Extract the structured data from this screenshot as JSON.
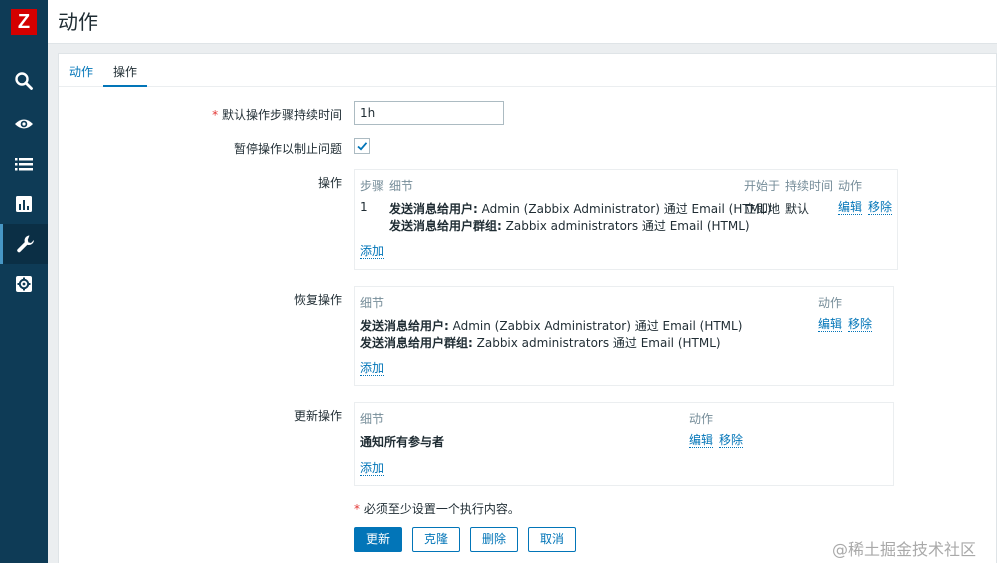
{
  "app": {
    "logo_text": "Z",
    "brand_color": "#d40000",
    "accent_color": "#0275b8"
  },
  "sidebar": {
    "items": [
      {
        "icon": "search-icon"
      },
      {
        "icon": "eye-icon"
      },
      {
        "icon": "list-icon"
      },
      {
        "icon": "chart-icon"
      },
      {
        "icon": "wrench-icon",
        "active": true
      },
      {
        "icon": "gear-icon"
      }
    ]
  },
  "header": {
    "title": "动作"
  },
  "tabs": [
    {
      "label": "动作"
    },
    {
      "label": "操作",
      "active": true
    }
  ],
  "form": {
    "step_duration": {
      "required_mark": "*",
      "label": "默认操作步骤持续时间",
      "value": "1h"
    },
    "pause": {
      "label": "暂停操作以制止问题",
      "checked": true
    },
    "operations": {
      "label": "操作",
      "headers": {
        "step": "步骤",
        "details": "细节",
        "start": "开始于",
        "duration": "持续时间",
        "action": "动作"
      },
      "rows": [
        {
          "step": "1",
          "line1_bold": "发送消息给用户:",
          "line1_text": " Admin (Zabbix Administrator) 通过 Email (HTML)",
          "line2_bold": "发送消息给用户群组:",
          "line2_text": " Zabbix administrators 通过 Email (HTML)",
          "start": "立即地",
          "duration": "默认",
          "edit": "编辑",
          "remove": "移除"
        }
      ],
      "add": "添加"
    },
    "recovery": {
      "label": "恢复操作",
      "headers": {
        "details": "细节",
        "action": "动作"
      },
      "rows": [
        {
          "line1_bold": "发送消息给用户:",
          "line1_text": " Admin (Zabbix Administrator) 通过 Email (HTML)",
          "line2_bold": "发送消息给用户群组:",
          "line2_text": " Zabbix administrators 通过 Email (HTML)",
          "edit": "编辑",
          "remove": "移除"
        }
      ],
      "add": "添加"
    },
    "update": {
      "label": "更新操作",
      "headers": {
        "details": "细节",
        "action": "动作"
      },
      "rows": [
        {
          "line1_bold": "通知所有参与者",
          "edit": "编辑",
          "remove": "移除"
        }
      ],
      "add": "添加"
    },
    "note": {
      "mark": "*",
      "text": " 必须至少设置一个执行内容。"
    },
    "buttons": {
      "update": "更新",
      "clone": "克隆",
      "delete": "删除",
      "cancel": "取消"
    }
  },
  "watermark": "@稀土掘金技术社区"
}
